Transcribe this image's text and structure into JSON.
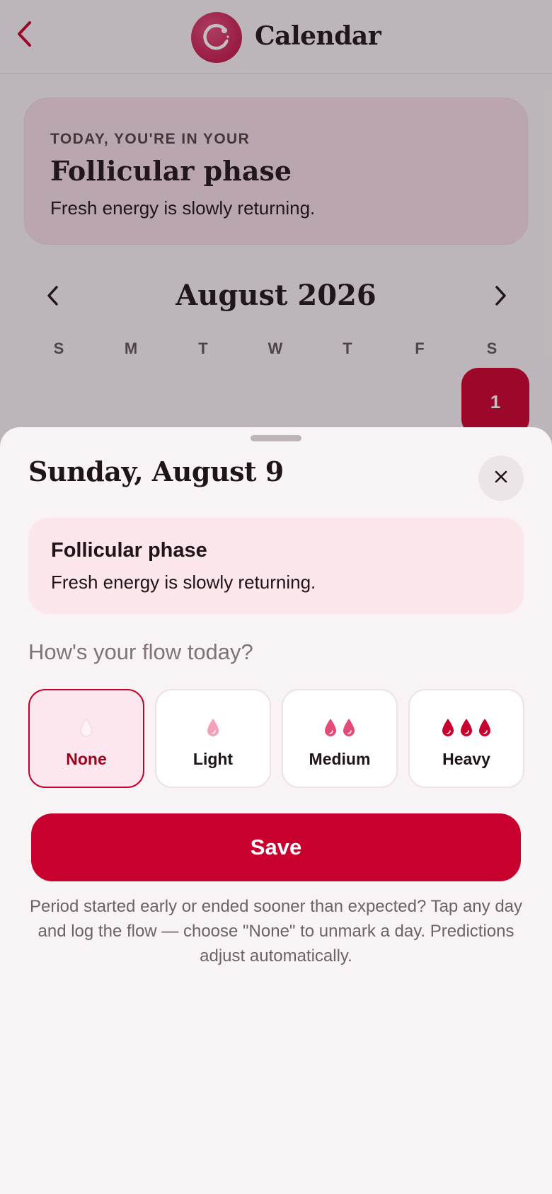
{
  "header": {
    "title": "Calendar",
    "back_icon": "chevron-left-icon",
    "logo_icon": "app-logo-icon"
  },
  "phase_banner": {
    "kicker": "TODAY, YOU'RE IN YOUR",
    "title": "Follicular phase",
    "description": "Fresh energy is slowly returning."
  },
  "calendar": {
    "month": "August 2026",
    "prev_icon": "chevron-left-icon",
    "next_icon": "chevron-right-icon",
    "weekdays": [
      "S",
      "M",
      "T",
      "W",
      "T",
      "F",
      "S"
    ],
    "visible_day": "1"
  },
  "sheet": {
    "title": "Sunday, August 9",
    "close_icon": "close-icon",
    "phase_card": {
      "title": "Follicular phase",
      "description": "Fresh energy is slowly returning."
    },
    "flow_question": "How's your flow today?",
    "flow_options": [
      {
        "label": "None",
        "drops": 0,
        "selected": true
      },
      {
        "label": "Light",
        "drops": 1,
        "selected": false
      },
      {
        "label": "Medium",
        "drops": 2,
        "selected": false
      },
      {
        "label": "Heavy",
        "drops": 3,
        "selected": false
      }
    ],
    "save_label": "Save",
    "hint": "Period started early or ended sooner than expected? Tap any day and log the flow — choose \"None\" to unmark a day. Predictions adjust automatically."
  },
  "colors": {
    "accent": "#c8002d",
    "light_drop": "#f3a0b8",
    "medium_drop": "#e44a78",
    "heavy_drop": "#c8002d"
  }
}
